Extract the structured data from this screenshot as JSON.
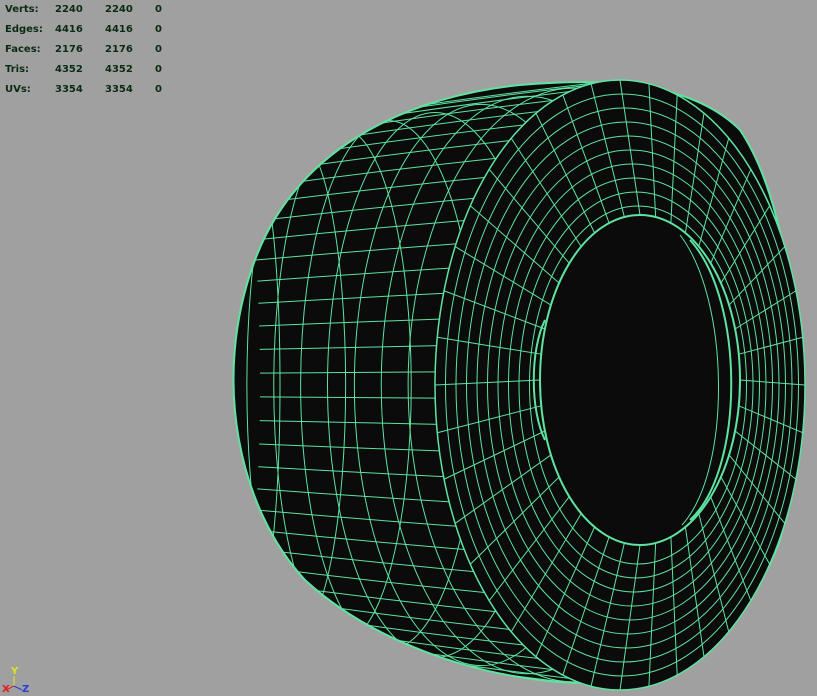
{
  "hud": {
    "rows": [
      {
        "label": "Verts:",
        "a": "2240",
        "b": "2240",
        "c": "0"
      },
      {
        "label": "Edges:",
        "a": "4416",
        "b": "4416",
        "c": "0"
      },
      {
        "label": "Faces:",
        "a": "2176",
        "b": "2176",
        "c": "0"
      },
      {
        "label": "Tris:",
        "a": "4352",
        "b": "4352",
        "c": "0"
      },
      {
        "label": "UVs:",
        "a": "3354",
        "b": "3354",
        "c": "0"
      }
    ]
  },
  "axis": {
    "x": "X",
    "y": "Y",
    "z": "Z"
  },
  "colors": {
    "background": "#a0a0a0",
    "wire": "#5fe3a1",
    "shade": "#0b0b0b",
    "text": "#0a2a12"
  }
}
